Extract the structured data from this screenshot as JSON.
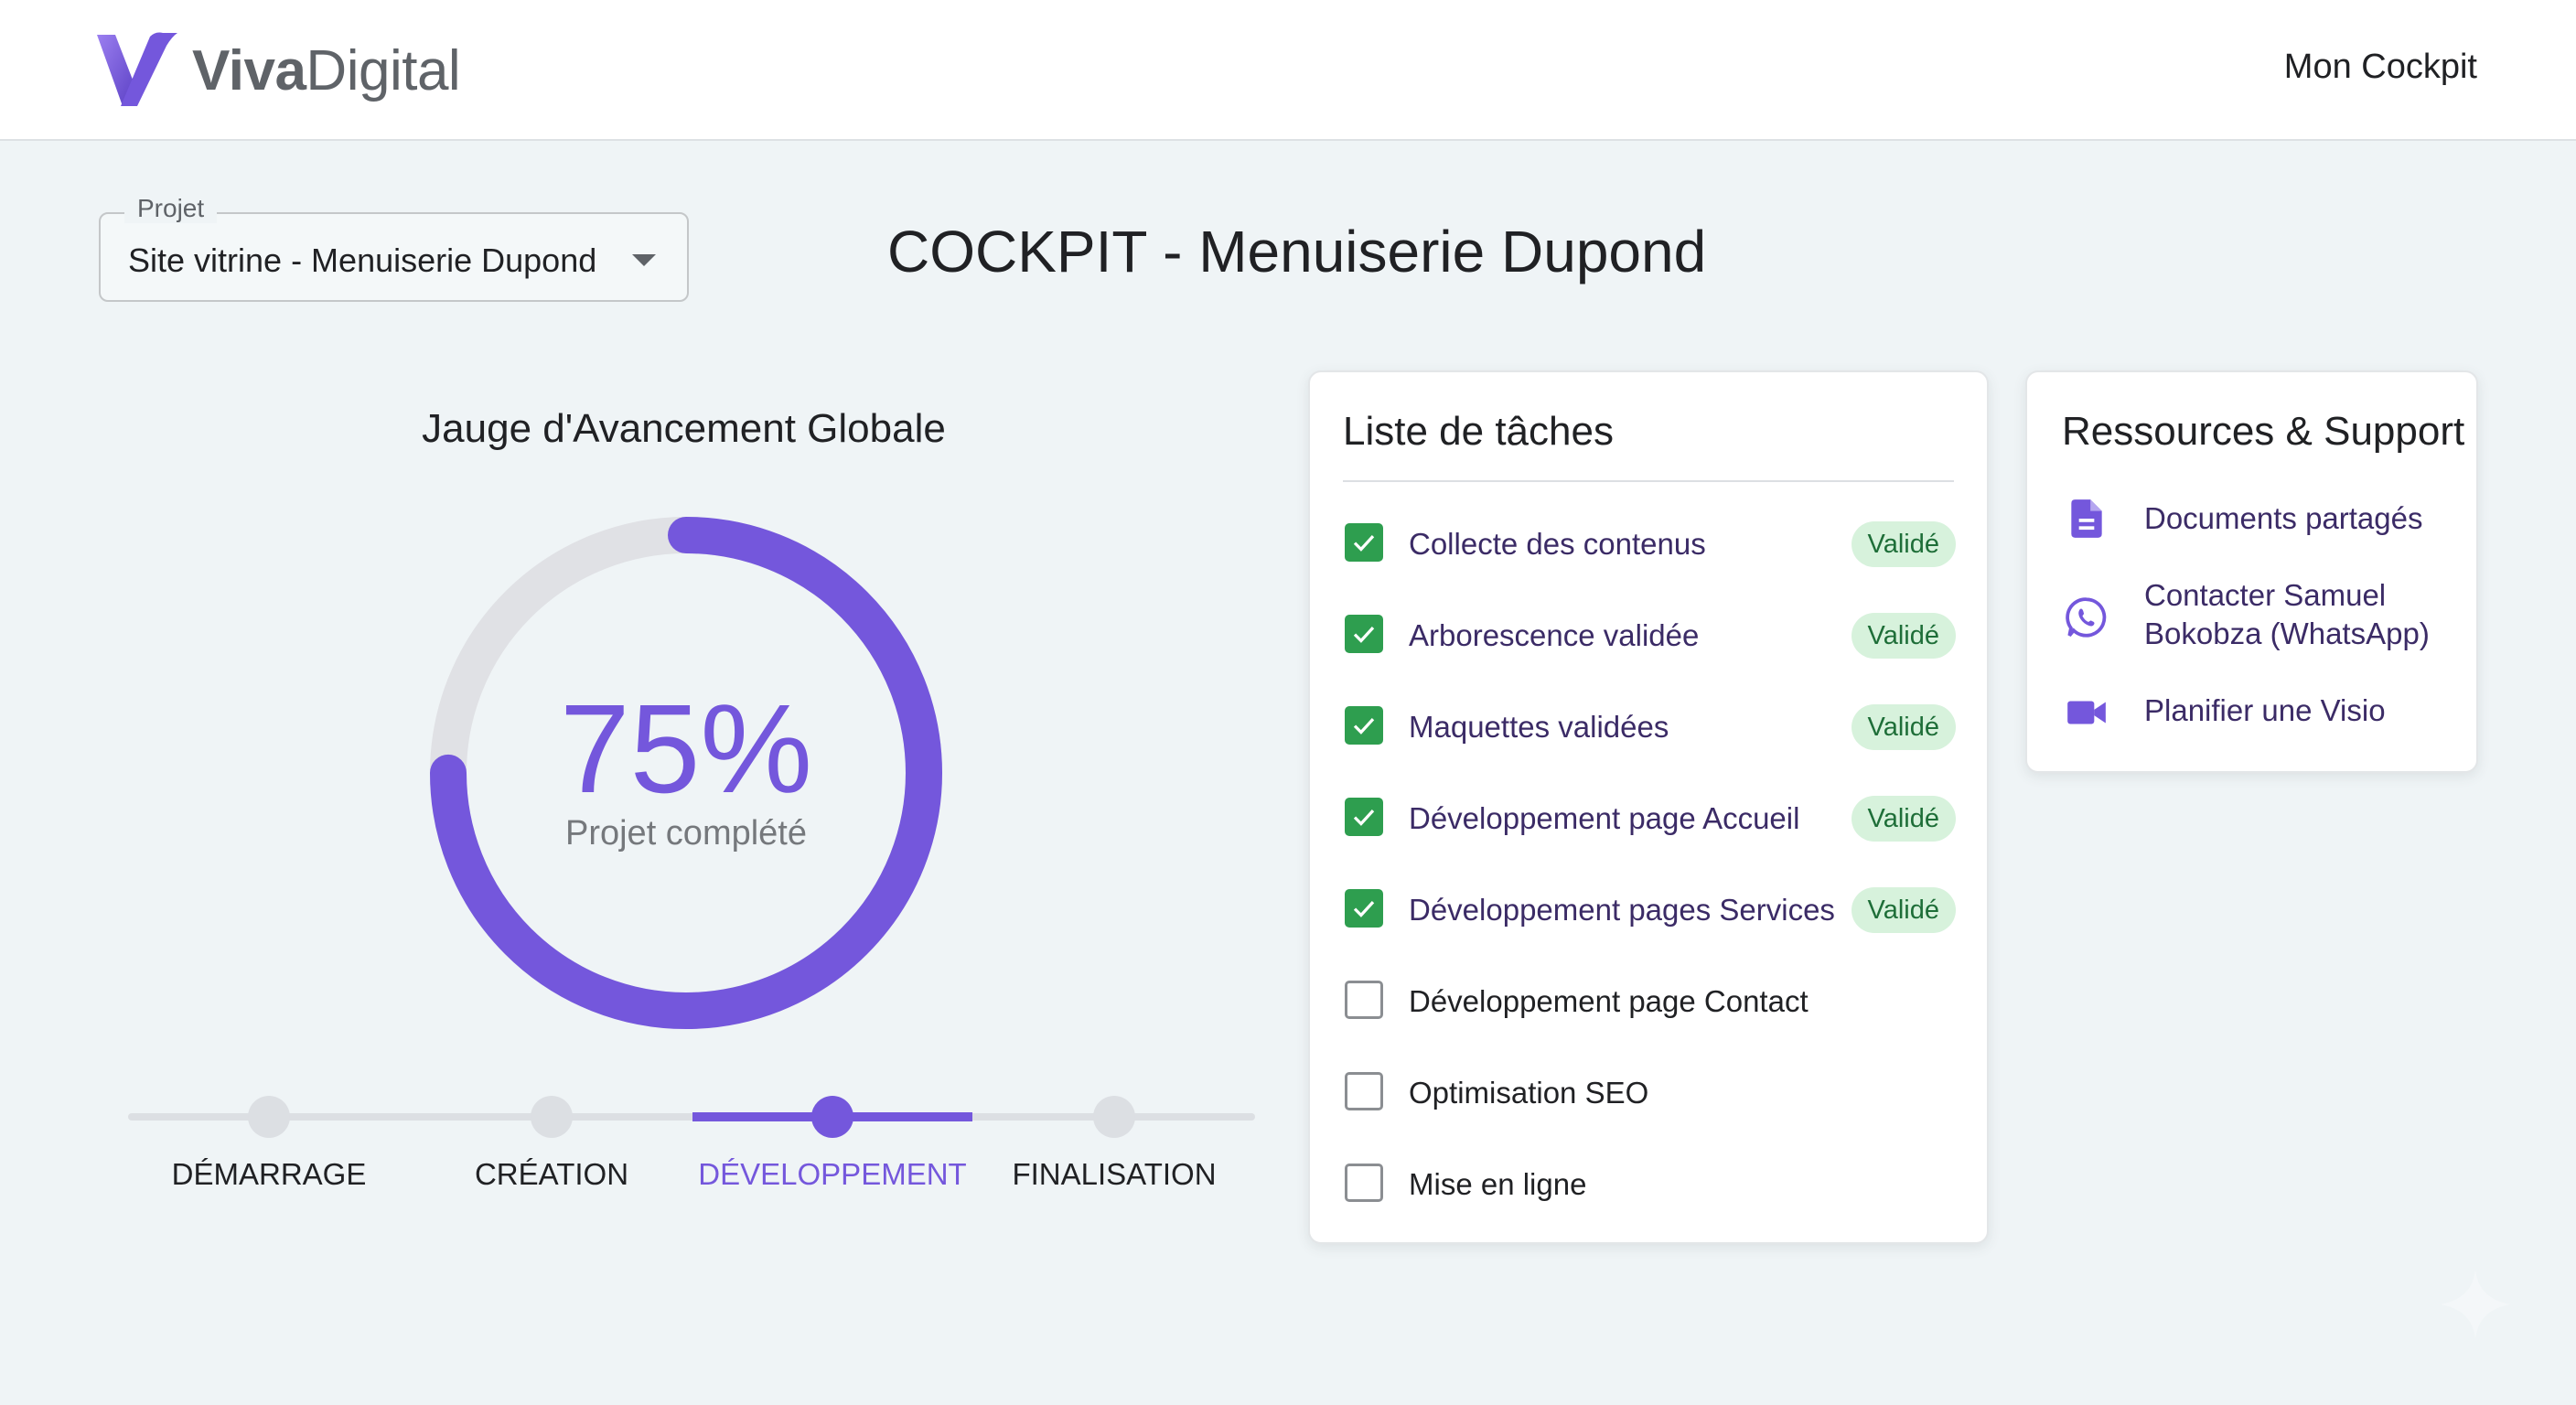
{
  "header": {
    "brand_bold": "Viva",
    "brand_regular": "Digital",
    "nav_link": "Mon Cockpit",
    "logo_icon": "viva-v-logo-icon"
  },
  "project_select": {
    "label": "Projet",
    "value": "Site vitrine - Menuiserie Dupond",
    "icon": "chevron-down-icon"
  },
  "page_title": "COCKPIT - Menuiserie Dupond",
  "gauge": {
    "title": "Jauge d'Avancement Globale",
    "value_text": "75%",
    "progress": 0.75,
    "subtitle": "Projet complété",
    "track_color": "#e0e1e5",
    "fill_color": "#7457dc"
  },
  "stepper": {
    "steps": [
      {
        "label": "DÉMARRAGE",
        "active": false
      },
      {
        "label": "CRÉATION",
        "active": false
      },
      {
        "label": "DÉVELOPPEMENT",
        "active": true
      },
      {
        "label": "FINALISATION",
        "active": false
      }
    ]
  },
  "tasks": {
    "title": "Liste de tâches",
    "items": [
      {
        "label": "Collecte des contenus",
        "checked": true,
        "badge": "Validé"
      },
      {
        "label": "Arborescence validée",
        "checked": true,
        "badge": "Validé"
      },
      {
        "label": "Maquettes validées",
        "checked": true,
        "badge": "Validé"
      },
      {
        "label": "Développement page Accueil",
        "checked": true,
        "badge": "Validé"
      },
      {
        "label": "Développement pages Services",
        "checked": true,
        "badge": "Validé"
      },
      {
        "label": "Développement page Contact",
        "checked": false,
        "badge": ""
      },
      {
        "label": "Optimisation SEO",
        "checked": false,
        "badge": ""
      },
      {
        "label": "Mise en ligne",
        "checked": false,
        "badge": ""
      }
    ]
  },
  "resources": {
    "title": "Ressources & Support",
    "items": [
      {
        "icon": "document-icon",
        "line1": "Documents partagés",
        "line2": ""
      },
      {
        "icon": "whatsapp-icon",
        "line1": "Contacter Samuel",
        "line2": "Bokobza (WhatsApp)"
      },
      {
        "icon": "video-camera-icon",
        "line1": "Planifier une Visio",
        "line2": ""
      }
    ]
  },
  "colors": {
    "accent": "#7457dc",
    "success": "#2e9e4f",
    "badge_bg": "#d7f2dc"
  }
}
